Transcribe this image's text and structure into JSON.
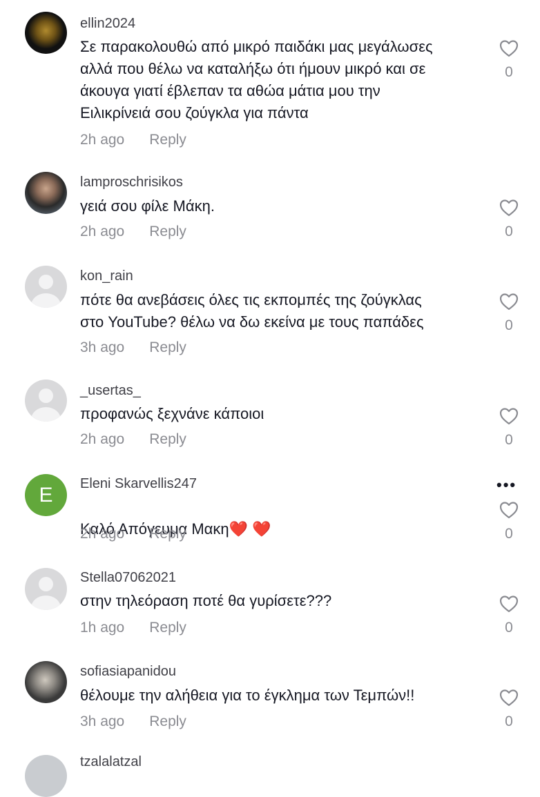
{
  "comments": [
    {
      "username": "ellin2024",
      "text": "Σε παρακολουθώ από μικρό παιδάκι μας μεγάλωσες\nαλλά που θέλω να καταλήξω ότι ήμουν μικρό και σε\nάκουγα γιατί έβλεπαν τα αθώα μάτια μου την\nΕιλικρίνειά σου ζούγκλα για πάντα",
      "time": "2h ago",
      "reply": "Reply",
      "likes": "0"
    },
    {
      "username": "lamproschrisikos",
      "text": "γειά σου φίλε Μάκη.",
      "time": "2h ago",
      "reply": "Reply",
      "likes": "0"
    },
    {
      "username": "kon_rain",
      "text": "πότε θα ανεβάσεις όλες τις εκπομπές της ζούγκλας\nστο YouTube? θέλω να δω εκείνα με τους παπάδες",
      "time": "3h ago",
      "reply": "Reply",
      "likes": "0"
    },
    {
      "username": "_usertas_",
      "text": "προφανώς ξεχνάνε κάποιοι",
      "time": "2h ago",
      "reply": "Reply",
      "likes": "0"
    },
    {
      "username": "Eleni Skarvellis247",
      "avatar_letter": "E",
      "text": "Καλό Απόγευμα Μακη",
      "emoji": "❤️ ❤️",
      "time": "2h ago",
      "reply": "Reply",
      "likes": "0",
      "more": "•••"
    },
    {
      "username": "Stella07062021",
      "text": "στην τηλεόραση ποτέ θα γυρίσετε???",
      "time": "1h ago",
      "reply": "Reply",
      "likes": "0"
    },
    {
      "username": "sofiasiapanidou",
      "text": "θέλουμε την αλήθεια για το έγκλημα των Τεμπών!!",
      "time": "3h ago",
      "reply": "Reply",
      "likes": "0"
    }
  ],
  "cutoff": {
    "username": "tzalalatzal"
  },
  "colors": {
    "text": "#161823",
    "muted": "#8a8b91",
    "avatar_placeholder": "#d9d9db",
    "letter_avatar": "#62a83b",
    "heart_red": "#e0202b"
  },
  "icons": {
    "like": "heart-outline-icon",
    "more": "more-horizontal-icon"
  }
}
